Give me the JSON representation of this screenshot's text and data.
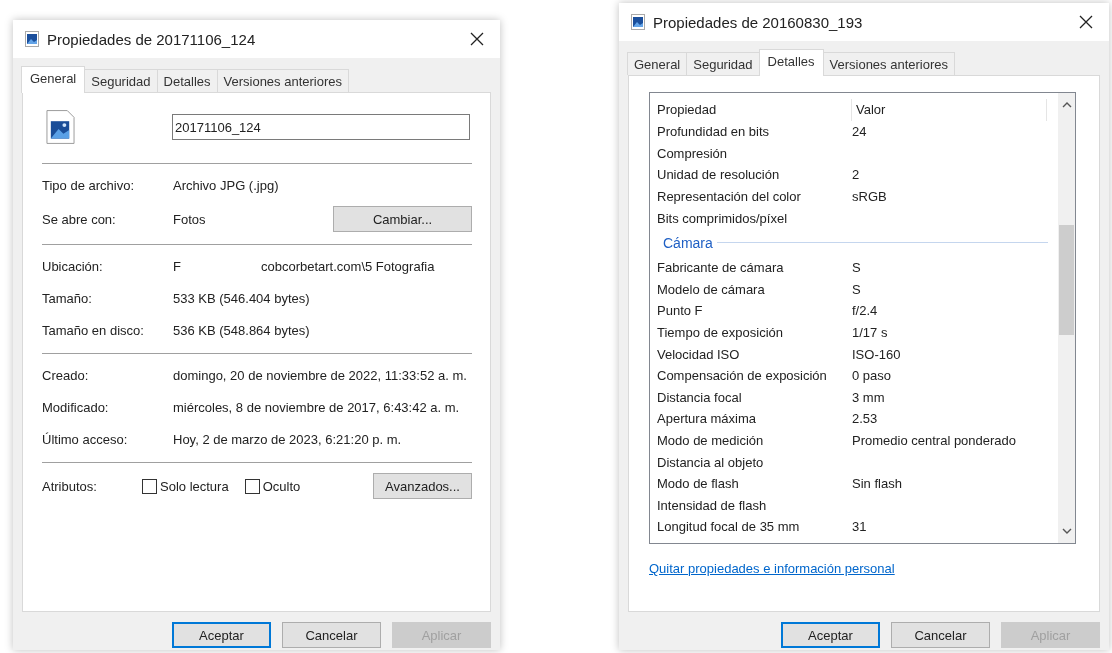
{
  "left_dialog": {
    "title": "Propiedades de 20171106_124",
    "tabs": [
      {
        "label": "General",
        "selected": true
      },
      {
        "label": "Seguridad",
        "selected": false
      },
      {
        "label": "Detalles",
        "selected": false
      },
      {
        "label": "Versiones anteriores",
        "selected": false
      }
    ],
    "name_field": {
      "value": "20171106_124"
    },
    "info_groups": [
      [
        {
          "label": "Tipo de archivo:",
          "values": [
            "Archivo JPG (.jpg)"
          ]
        },
        {
          "label": "Se abre con:",
          "values": [
            "Fotos"
          ],
          "button": "Cambiar..."
        }
      ],
      [
        {
          "label": "Ubicación:",
          "values": [
            "F",
            "cobcorbetart.com\\5 Fotografia"
          ]
        },
        {
          "label": "Tamaño:",
          "values": [
            "533 KB (546.404 bytes)"
          ]
        },
        {
          "label": "Tamaño en disco:",
          "values": [
            "536 KB (548.864 bytes)"
          ]
        }
      ],
      [
        {
          "label": "Creado:",
          "values": [
            "domingo, 20 de noviembre de 2022, 11:33:52 a. m."
          ]
        },
        {
          "label": "Modificado:",
          "values": [
            "miércoles, 8 de noviembre de 2017, 6:43:42 a. m."
          ]
        },
        {
          "label": "Último acceso:",
          "values": [
            "Hoy, 2 de marzo de 2023, 6:21:20 p. m."
          ]
        }
      ]
    ],
    "attributes": {
      "label": "Atributos:",
      "checkboxes": [
        {
          "label": "Solo lectura",
          "checked": false
        },
        {
          "label": "Oculto",
          "checked": false
        }
      ],
      "button": "Avanzados..."
    },
    "buttons": [
      {
        "label": "Aceptar",
        "default": true,
        "disabled": false
      },
      {
        "label": "Cancelar",
        "default": false,
        "disabled": false
      },
      {
        "label": "Aplicar",
        "default": false,
        "disabled": true
      }
    ]
  },
  "right_dialog": {
    "title": "Propiedades de 20160830_193",
    "tabs": [
      {
        "label": "General",
        "selected": false
      },
      {
        "label": "Seguridad",
        "selected": false
      },
      {
        "label": "Detalles",
        "selected": true
      },
      {
        "label": "Versiones anteriores",
        "selected": false
      }
    ],
    "columns": [
      "Propiedad",
      "Valor"
    ],
    "rows": [
      {
        "kind": "row",
        "name": "Profundidad en bits",
        "value": "24"
      },
      {
        "kind": "row",
        "name": "Compresión"
      },
      {
        "kind": "row",
        "name": "Unidad de resolución",
        "value": "2"
      },
      {
        "kind": "row",
        "name": "Representación del color",
        "value": "sRGB"
      },
      {
        "kind": "row",
        "name": "Bits comprimidos/píxel"
      },
      {
        "kind": "group",
        "name": "Cámara"
      },
      {
        "kind": "row",
        "name": "Fabricante de cámara",
        "value": "S"
      },
      {
        "kind": "row",
        "name": "Modelo de cámara",
        "value": "S"
      },
      {
        "kind": "row",
        "name": "Punto F",
        "value": "f/2.4"
      },
      {
        "kind": "row",
        "name": "Tiempo de exposición",
        "value": "1/17 s"
      },
      {
        "kind": "row",
        "name": "Velocidad ISO",
        "value": "ISO-160"
      },
      {
        "kind": "row",
        "name": "Compensación de exposición",
        "value": "0 paso"
      },
      {
        "kind": "row",
        "name": "Distancia focal",
        "value": "3 mm"
      },
      {
        "kind": "row",
        "name": "Apertura máxima",
        "value": "2.53"
      },
      {
        "kind": "row",
        "name": "Modo de medición",
        "value": "Promedio central ponderado"
      },
      {
        "kind": "row",
        "name": "Distancia al objeto"
      },
      {
        "kind": "row",
        "name": "Modo de flash",
        "value": "Sin flash"
      },
      {
        "kind": "row",
        "name": "Intensidad de flash"
      },
      {
        "kind": "row",
        "name": "Longitud focal de 35 mm",
        "value": "31"
      }
    ],
    "link": "Quitar propiedades e información personal",
    "buttons": [
      {
        "label": "Aceptar",
        "default": true,
        "disabled": false
      },
      {
        "label": "Cancelar",
        "default": false,
        "disabled": false
      },
      {
        "label": "Aplicar",
        "default": false,
        "disabled": true
      }
    ]
  }
}
